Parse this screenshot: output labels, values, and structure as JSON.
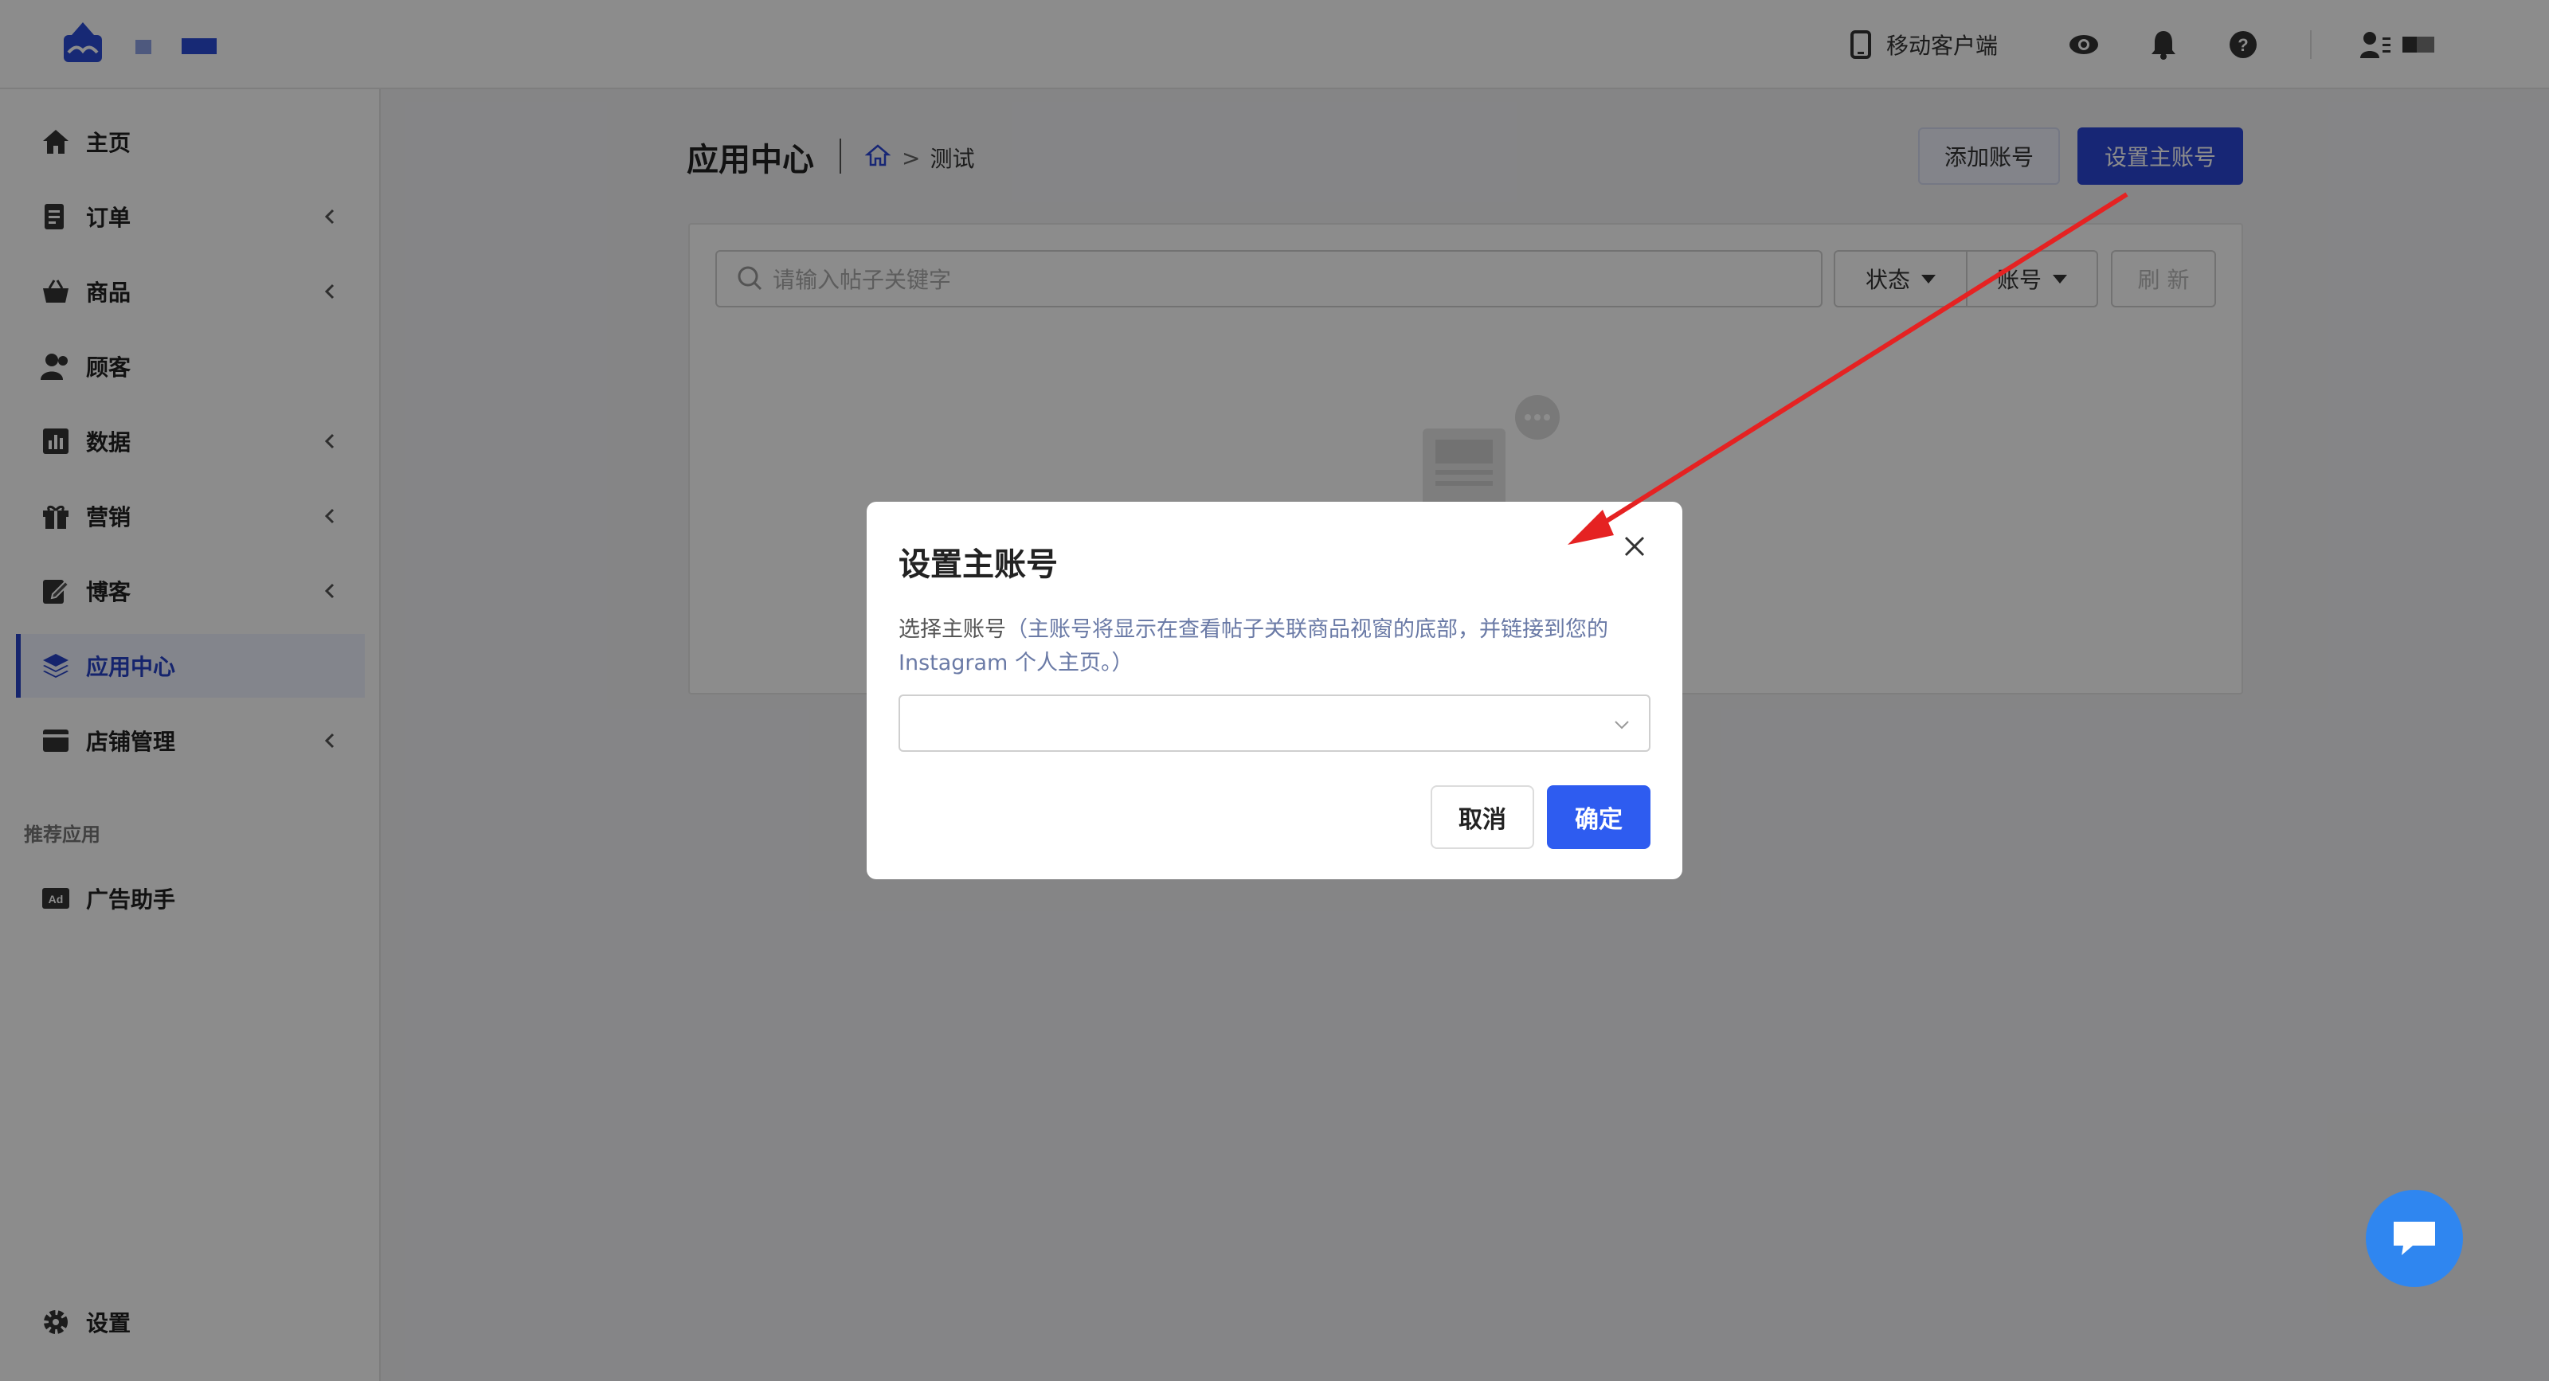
{
  "header": {
    "mobile_client_label": "移动客户端",
    "icons": [
      "mobile-icon",
      "eye-icon",
      "bell-icon",
      "help-icon",
      "user-icon"
    ]
  },
  "sidebar": {
    "items": [
      {
        "label": "主页",
        "icon": "home-icon"
      },
      {
        "label": "订单",
        "icon": "order-icon"
      },
      {
        "label": "商品",
        "icon": "basket-icon"
      },
      {
        "label": "顾客",
        "icon": "customers-icon"
      },
      {
        "label": "数据",
        "icon": "chart-icon"
      },
      {
        "label": "营销",
        "icon": "gift-icon"
      },
      {
        "label": "博客",
        "icon": "edit-icon"
      },
      {
        "label": "应用中心",
        "icon": "layers-icon"
      },
      {
        "label": "店铺管理",
        "icon": "store-icon"
      }
    ],
    "section_title": "推荐应用",
    "recommended": [
      {
        "label": "广告助手",
        "icon": "ad-icon"
      }
    ],
    "settings_label": "设置",
    "active_color": "#2743c7"
  },
  "main": {
    "page_title": "应用中心",
    "breadcrumb_current": "测试",
    "breadcrumb_sep": ">",
    "add_account_label": "添加账号",
    "set_main_account_label": "设置主账号",
    "search_placeholder": "请输入帖子关键字",
    "filter_status": "状态",
    "filter_account": "账号",
    "refresh_label": "刷 新"
  },
  "modal": {
    "title": "设置主账号",
    "desc_prefix": "选择主账号",
    "desc_note": "（主账号将显示在查看帖子关联商品视窗的底部，并链接到您的",
    "desc_note2": "Instagram 个人主页。）",
    "select_value": "",
    "cancel_label": "取消",
    "ok_label": "确定",
    "primary_color": "#2e5cf0"
  }
}
